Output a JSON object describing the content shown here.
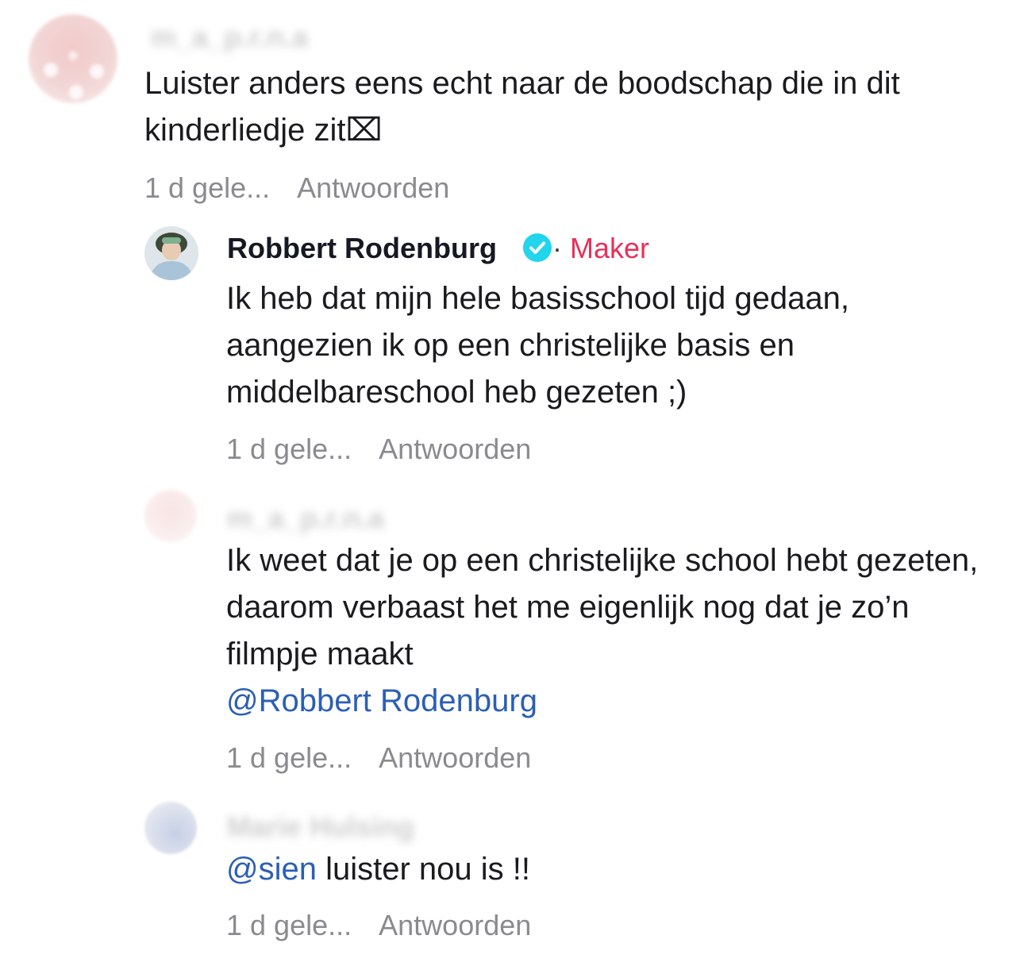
{
  "comments": [
    {
      "username": "m_a_p.r.n.a",
      "text": "Luister anders eens echt naar de boodschap die in dit kinderliedje zit",
      "emoji": "⌧",
      "time": "1 d gele...",
      "reply": "Antwoorden"
    },
    {
      "username": "Robbert Rodenburg",
      "badge_sep": "·",
      "badge": "Maker",
      "text": "Ik heb dat mijn hele basisschool tijd gedaan, aangezien ik op een christelijke basis en middelbareschool heb gezeten ;)",
      "time": "1 d gele...",
      "reply": "Antwoorden"
    },
    {
      "username": "m_a_p.r.n.a",
      "text": "Ik weet dat je op een christelijke school hebt gezeten, daarom verbaast het me eigenlijk nog dat je zo’n filmpje maakt",
      "mention": "@Robbert Rodenburg",
      "time": "1 d gele...",
      "reply": "Antwoorden"
    },
    {
      "username": "Marie Hulsing",
      "mention": "@sien",
      "text": " luister nou is !!",
      "time": "1 d gele...",
      "reply": "Antwoorden"
    }
  ],
  "colors": {
    "maker": "#e8305a",
    "mention": "#2b5fb5",
    "verified": "#20d5ec",
    "meta": "#8a8a8f"
  }
}
